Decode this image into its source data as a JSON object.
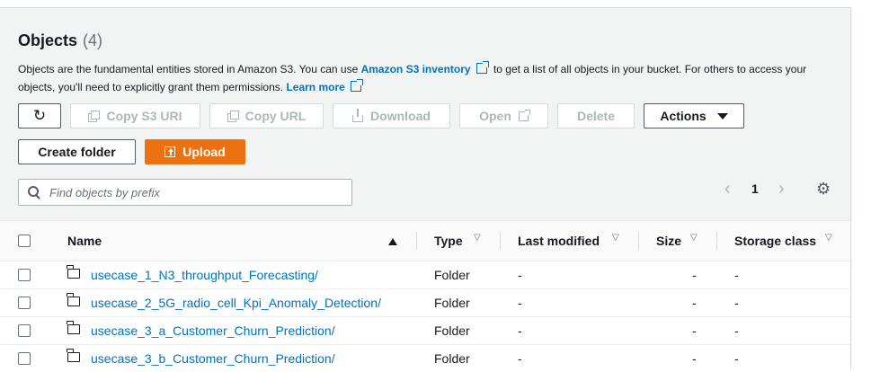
{
  "header": {
    "title": "Objects",
    "count": "(4)",
    "description_part1": "Objects are the fundamental entities stored in Amazon S3. You can use ",
    "inventory_link": "Amazon S3 inventory",
    "description_part2": " to get a list of all objects in your bucket. For others to access your objects, you'll need to explicitly grant them permissions. ",
    "learn_more": "Learn more"
  },
  "toolbar": {
    "refresh_icon": "refresh-icon",
    "copy_s3_uri": "Copy S3 URI",
    "copy_url": "Copy URL",
    "download": "Download",
    "open": "Open",
    "delete": "Delete",
    "actions": "Actions",
    "create_folder": "Create folder",
    "upload": "Upload"
  },
  "search": {
    "placeholder": "Find objects by prefix",
    "value": ""
  },
  "pagination": {
    "prev": "‹",
    "page": "1",
    "next": "›"
  },
  "table": {
    "columns": {
      "name": "Name",
      "type": "Type",
      "last_modified": "Last modified",
      "size": "Size",
      "storage_class": "Storage class"
    },
    "rows": [
      {
        "name": "usecase_1_N3_throughput_Forecasting/",
        "type": "Folder",
        "last_modified": "-",
        "size": "-",
        "storage_class": "-"
      },
      {
        "name": "usecase_2_5G_radio_cell_Kpi_Anomaly_Detection/",
        "type": "Folder",
        "last_modified": "-",
        "size": "-",
        "storage_class": "-"
      },
      {
        "name": "usecase_3_a_Customer_Churn_Prediction/",
        "type": "Folder",
        "last_modified": "-",
        "size": "-",
        "storage_class": "-"
      },
      {
        "name": "usecase_3_b_Customer_Churn_Prediction/",
        "type": "Folder",
        "last_modified": "-",
        "size": "-",
        "storage_class": "-"
      }
    ]
  },
  "colors": {
    "accent": "#ec7211",
    "link": "#0073bb",
    "text": "#16191f",
    "muted": "#687078"
  }
}
